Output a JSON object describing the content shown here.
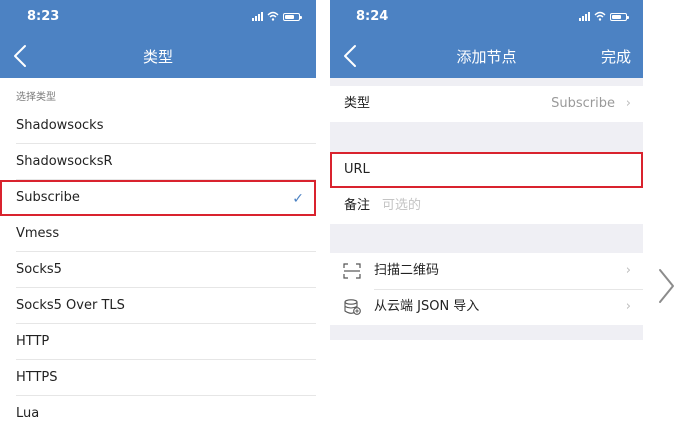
{
  "left_screen": {
    "status_time": "8:23",
    "nav_title": "类型",
    "section_label": "选择类型",
    "check_mark": "✓",
    "types": [
      {
        "label": "Shadowsocks"
      },
      {
        "label": "ShadowsocksR"
      },
      {
        "label": "Subscribe"
      },
      {
        "label": "Vmess"
      },
      {
        "label": "Socks5"
      },
      {
        "label": "Socks5 Over TLS"
      },
      {
        "label": "HTTP"
      },
      {
        "label": "HTTPS"
      },
      {
        "label": "Lua"
      }
    ],
    "selected_type": "Subscribe"
  },
  "right_screen": {
    "status_time": "8:24",
    "nav_title": "添加节点",
    "done_label": "完成",
    "type_row": {
      "label": "类型",
      "value": "Subscribe",
      "chevron": "›"
    },
    "url_row": {
      "label": "URL",
      "value": ""
    },
    "note_row": {
      "label": "备注",
      "placeholder": "可选的"
    },
    "actions": [
      {
        "label": "扫描二维码",
        "icon": "scan-qr-icon",
        "chevron": "›"
      },
      {
        "label": "从云端 JSON 导入",
        "icon": "cloud-database-icon",
        "chevron": "›"
      }
    ]
  },
  "colors": {
    "header": "#4c82c3",
    "highlight": "#d9232e",
    "check": "#4c82c3",
    "group_background": "#efeff4"
  },
  "icons": {
    "back": "chevron-left-icon",
    "next": "chevron-right-icon",
    "signal": "signal-icon",
    "wifi": "wifi-icon",
    "battery": "battery-icon"
  }
}
